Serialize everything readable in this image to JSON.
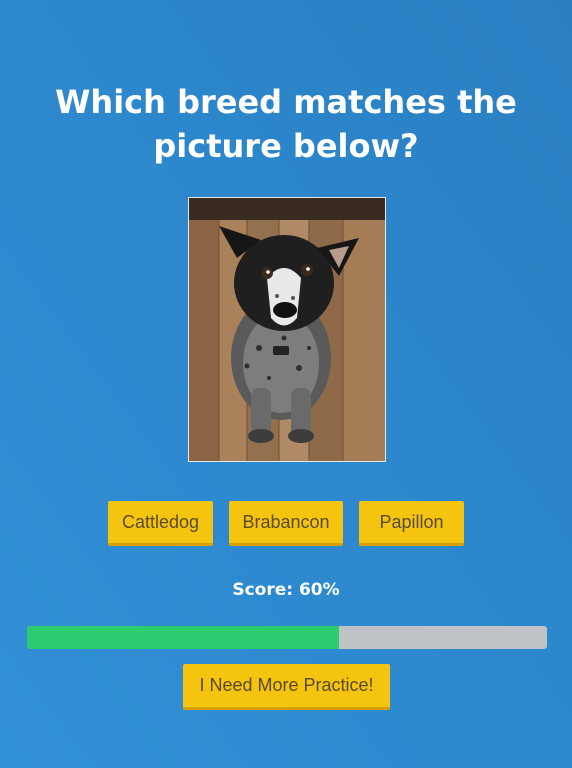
{
  "quiz": {
    "question_line1": "Which breed matches the",
    "question_line2": "picture below?",
    "answers": [
      {
        "label": "Cattledog"
      },
      {
        "label": "Brabancon"
      },
      {
        "label": "Papillon"
      }
    ],
    "score_text": "Score: 60%",
    "progress_fraction": 0.6,
    "practice_label": "I Need More Practice!"
  },
  "colors": {
    "background": "#2d88cd",
    "button": "#f5c40e",
    "progress_fill": "#2ecc71",
    "progress_track": "#bfc3c7"
  }
}
